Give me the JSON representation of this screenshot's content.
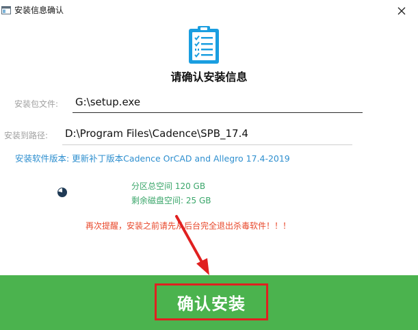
{
  "window": {
    "title": "安装信息确认",
    "app_icon": "app-window-icon",
    "close_icon": "close-icon"
  },
  "main": {
    "icon": "clipboard-checklist-icon",
    "heading": "请确认安装信息"
  },
  "fields": {
    "package_label": "安装包文件:",
    "package_value": "G:\\setup.exe",
    "path_label": "安装到路径:",
    "path_value": "D:\\Program Files\\Cadence\\SPB_17.4"
  },
  "version": {
    "text": "安装软件版本: 更新补丁版本Cadence OrCAD and Allegro 17.4-2019"
  },
  "disk": {
    "icon": "disk-usage-pie-icon",
    "used_fraction": 0.79,
    "total_text": "分区总空间 120 GB",
    "free_text": "剩余磁盘空间: 25 GB"
  },
  "warning": {
    "text": "再次提醒，安装之前请先从后台完全退出杀毒软件！！！"
  },
  "annotation": {
    "arrow_icon": "red-arrow-annotation"
  },
  "actions": {
    "confirm_label": "确认安装"
  },
  "colors": {
    "accent_blue": "#2e8fcf",
    "disk_green": "#3aa66a",
    "warning_red": "#e8472a",
    "button_bar_green": "#4bb34e",
    "highlight_red": "#e02020"
  }
}
